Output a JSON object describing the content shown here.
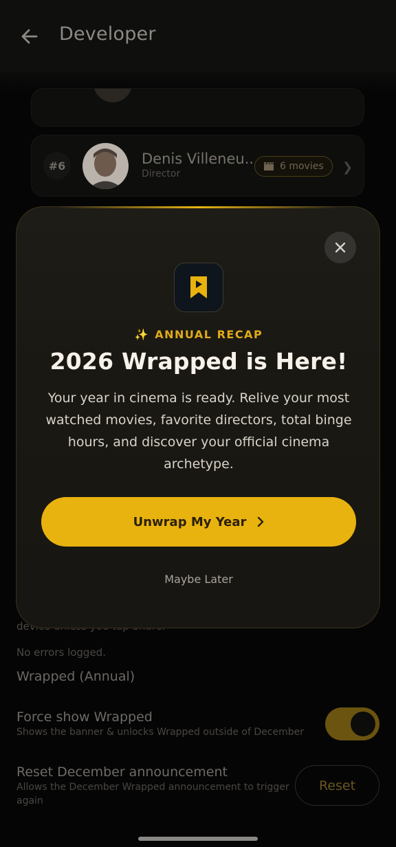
{
  "appbar": {
    "title": "Developer",
    "back_icon": "arrow-left-icon"
  },
  "list": {
    "item": {
      "rank": "#6",
      "name": "Denis Villeneu...",
      "role": "Director",
      "movies": "6 movies"
    }
  },
  "settings": {
    "partial_text": "device unless you tap Share.",
    "errors_text": "No errors logged.",
    "section_title": "Wrapped (Annual)",
    "force_show": {
      "title": "Force show Wrapped",
      "desc": "Shows the banner & unlocks Wrapped outside of December",
      "enabled": true
    },
    "reset_announcement": {
      "title": "Reset December announcement",
      "desc_line1": "Allows the December Wrapped announcement to trigger",
      "desc_line2": "again",
      "button": "Reset"
    }
  },
  "modal": {
    "eyebrow": "ANNUAL RECAP",
    "title": "2026 Wrapped is Here!",
    "body": "Your year in cinema is ready. Relive your most watched movies, favorite directors, total binge hours, and discover your official cinema archetype.",
    "cta": "Unwrap My Year",
    "later": "Maybe Later"
  },
  "colors": {
    "accent": "#e8b30f",
    "modal_bg": "#1c1a15",
    "background": "#050505"
  }
}
